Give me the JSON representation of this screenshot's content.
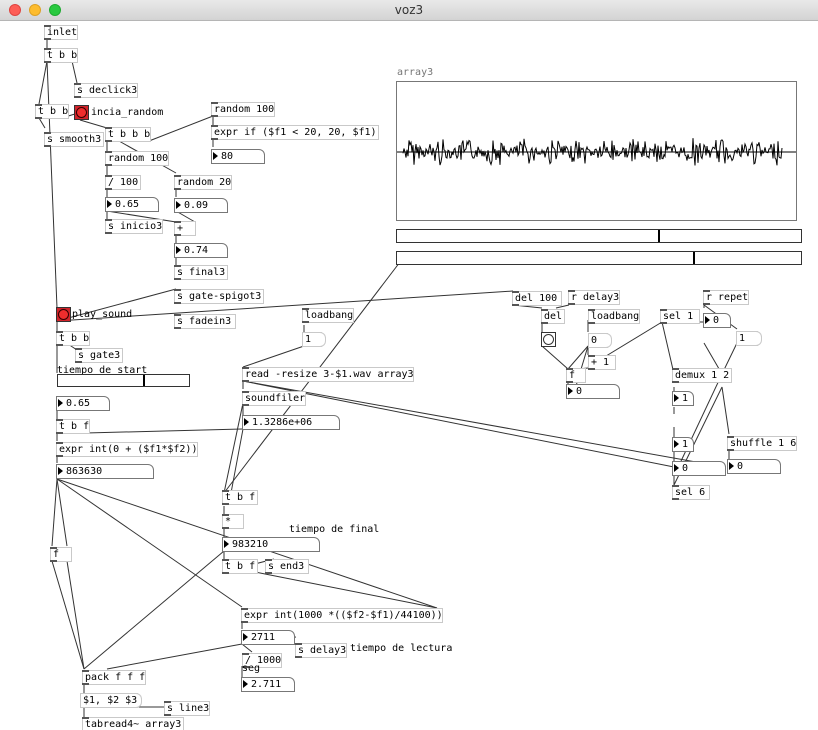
{
  "window": {
    "title": "voz3",
    "close_color": "#fd5d56",
    "minimize_color": "#fdbc2e",
    "zoom_color": "#29c940"
  },
  "objects": {
    "inlet": "inlet",
    "t_b_b_1": "t b b",
    "s_declick3": "s declick3",
    "t_b_b_2": "t b b",
    "incia_random": "incia_random",
    "s_smooth3": "s smooth3",
    "t_b_b_b": "t b b b",
    "random_100_a": "random 100",
    "random_100_b": "random 100",
    "expr_if": "expr if ($f1 < 20, 20, $f1)",
    "div_100": "/ 100",
    "random_20": "random 20",
    "s_inicio3": "s inicio3",
    "plus": "+",
    "s_final3": "s final3",
    "s_gate_spigot3": "s gate-spigot3",
    "s_fadein3": "s fadein3",
    "play_sound": "play_sound",
    "t_b_b_3": "t b b",
    "s_gate3": "s gate3",
    "tiempo_de_start": "tiempo de start",
    "t_b_f_1": "t b f",
    "expr_int_start": "expr int(0 + ($f1*$f2))",
    "loadbang_1": "loadbang",
    "read_resize": "read -resize 3-$1.wav array3",
    "soundfiler": "soundfiler",
    "t_b_f_2": "t b f",
    "mult": "*",
    "tiempo_de_final": "tiempo de final",
    "t_b_f_3": "t b f",
    "s_end3": "s end3",
    "f_1": "f",
    "expr_int_lectura": "expr int(1000 *(($f2-$f1)/44100))",
    "s_delay3": "s delay3",
    "tiempo_de_lectura": "tiempo de lectura",
    "div_1000": "/ 1000",
    "seg": "seg",
    "pack_fff": "pack f f f",
    "s_line3": "s line3",
    "tabread4": "tabread4~ array3",
    "del_100": "del 100",
    "r_delay3": "r delay3",
    "del": "del",
    "loadbang_2": "loadbang",
    "sel_1": "sel 1",
    "r_repet": "r repet",
    "f_2": "f",
    "plus_1": "+ 1",
    "demux": "demux 1 2",
    "shuffle": "shuffle 1 6",
    "sel_6": "sel 6"
  },
  "messages": {
    "msg_1": "1",
    "msg_1_b": "1",
    "msg_list": "$1, $2 $3"
  },
  "numbers": {
    "n_80": "80",
    "n_065_a": "0.65",
    "n_009": "0.09",
    "n_074": "0.74",
    "n_065_b": "0.65",
    "n_start": "863630",
    "n_1328": "1.3286e+06",
    "n_983210": "983210",
    "n_2711": "2711",
    "n_2_711": "2.711",
    "n_0_a": "0",
    "n_0_b": "0",
    "n_0_c": "0",
    "n_0_d": "0",
    "n_0_e": "0",
    "n_1_a": "1",
    "n_1_b": "1"
  },
  "array": {
    "name": "array3"
  },
  "sliders": {
    "start_slider_value": 0.65,
    "array_slider_1_value": 0.65,
    "array_slider_2_value": 0.74
  }
}
